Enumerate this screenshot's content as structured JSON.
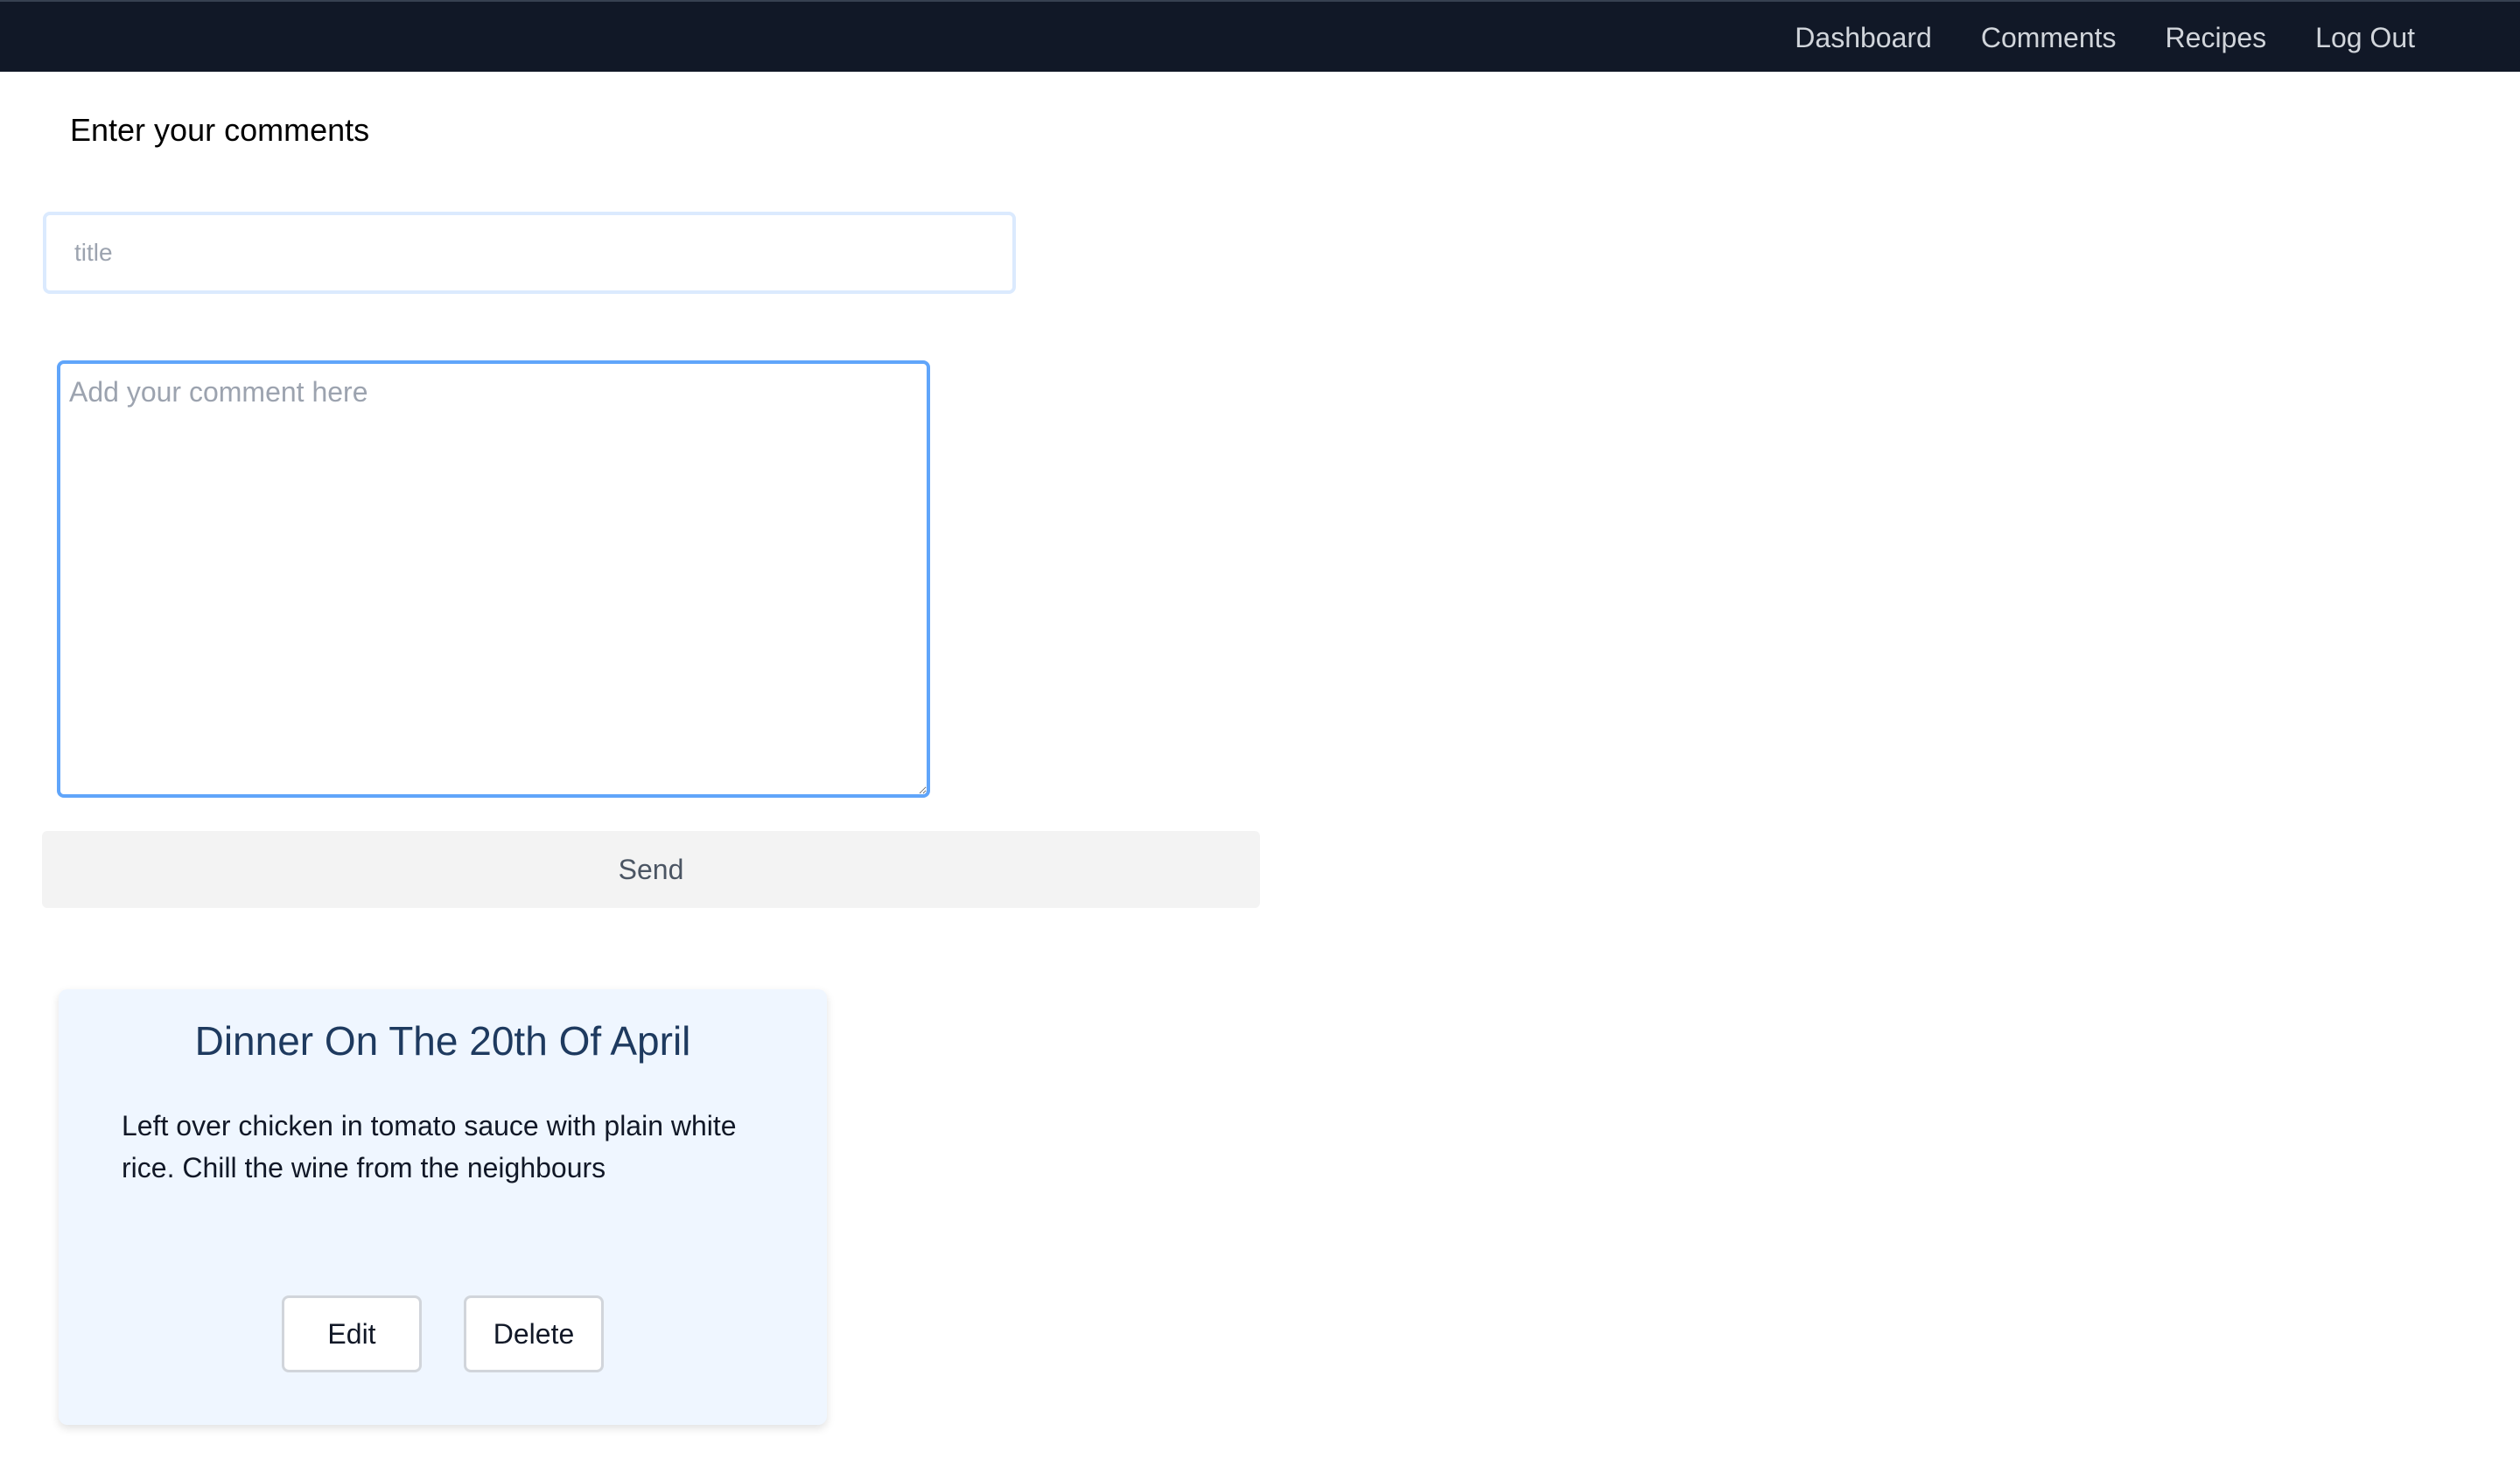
{
  "nav": {
    "items": [
      {
        "label": "Dashboard"
      },
      {
        "label": "Comments"
      },
      {
        "label": "Recipes"
      },
      {
        "label": "Log Out"
      }
    ]
  },
  "form": {
    "heading": "Enter your comments",
    "title_placeholder": "title",
    "title_value": "",
    "comment_placeholder": "Add your comment here",
    "comment_value": "",
    "send_label": "Send"
  },
  "comments": [
    {
      "title": "Dinner On The 20th Of April",
      "body": "Left over chicken in tomato sauce with plain white rice. Chill the wine from the neighbours",
      "edit_label": "Edit",
      "delete_label": "Delete"
    }
  ],
  "colors": {
    "navbar_bg": "#111827",
    "nav_text": "#d1d5db",
    "card_bg": "#eff6ff",
    "card_title": "#1e3a5f",
    "textarea_border": "#60a5fa",
    "send_bg": "#f3f3f3"
  }
}
